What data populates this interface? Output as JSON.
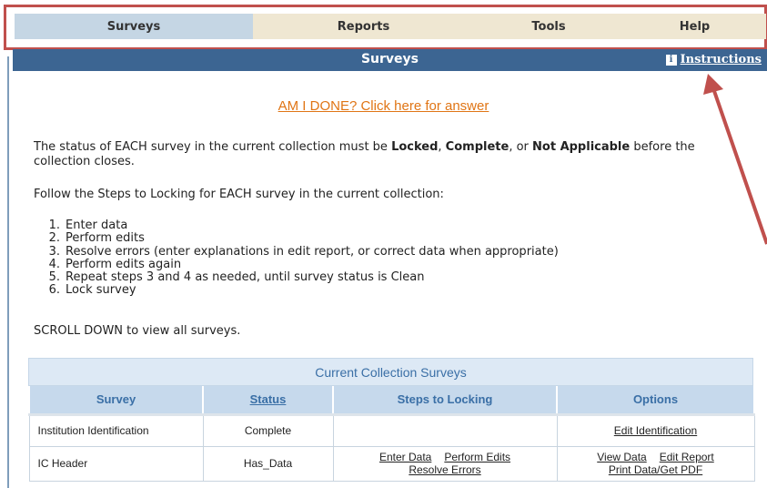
{
  "nav": {
    "tabs": [
      {
        "label": "Surveys",
        "active": true
      },
      {
        "label": "Reports",
        "active": false
      },
      {
        "label": "Tools",
        "active": false
      },
      {
        "label": "Help",
        "active": false
      }
    ]
  },
  "titlebar": {
    "title": "Surveys",
    "instructions_label": "Instructions",
    "info_icon": "info-icon"
  },
  "done_link": "AM I DONE? Click here for answer",
  "status_paragraph": {
    "before": "The status of EACH survey in the current collection must be ",
    "locked": "Locked",
    "sep1": ", ",
    "complete": "Complete",
    "sep2": ", or ",
    "not_applicable": "Not Applicable",
    "after": " before the collection closes."
  },
  "follow_text": "Follow the Steps to Locking for EACH survey in the current collection:",
  "steps": [
    {
      "num": "1.",
      "text": "Enter data"
    },
    {
      "num": "2.",
      "text": "Perform edits"
    },
    {
      "num": "3.",
      "text": "Resolve errors (enter explanations in edit report, or correct data when appropriate)"
    },
    {
      "num": "4.",
      "text": "Perform edits again"
    },
    {
      "num": "5.",
      "text": "Repeat steps 3 and 4 as needed, until survey status is Clean"
    },
    {
      "num": "6.",
      "text": "Lock survey"
    }
  ],
  "scroll_text": "SCROLL DOWN to view all surveys.",
  "table": {
    "caption": "Current Collection Surveys",
    "headers": {
      "survey": "Survey",
      "status": "Status",
      "steps": "Steps to Locking",
      "options": "Options"
    },
    "rows": [
      {
        "survey": "Institution Identification",
        "status": "Complete",
        "option1": "Edit Identification"
      },
      {
        "survey": "IC Header",
        "status": "Has_Data",
        "step1": "Enter Data",
        "step2": "Perform Edits",
        "step3": "Resolve Errors",
        "option1": "View Data",
        "option2": "Edit Report",
        "option3": "Print Data/Get PDF"
      }
    ]
  },
  "colors": {
    "nav_highlight": "#c0504d",
    "title_bar": "#3c6592",
    "done_link": "#e07515",
    "arrow": "#c0504d"
  }
}
